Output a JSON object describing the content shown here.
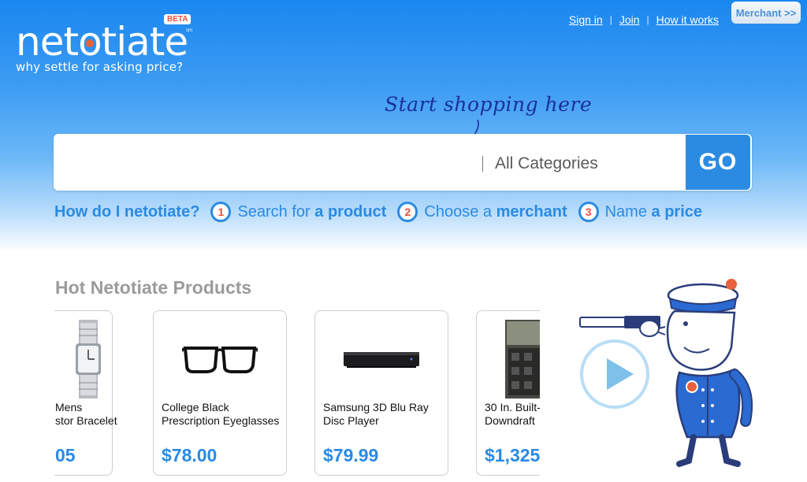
{
  "logo": {
    "name_a": "net",
    "name_b": "tiate",
    "beta": "BETA",
    "sm": "sm",
    "tagline": "why settle for asking price?"
  },
  "nav": {
    "sign_in": "Sign in",
    "separator": "|",
    "join": "Join",
    "how_it_works": "How it works",
    "merchant": "Merchant >>"
  },
  "hint": "Start shopping here",
  "search": {
    "value": "",
    "placeholder": "",
    "category": "All Categories",
    "go": "GO"
  },
  "howto": {
    "question": "How do I netotiate?",
    "steps": [
      {
        "num": "1",
        "prefix": "Search for",
        "bold": "a product"
      },
      {
        "num": "2",
        "prefix": "Choose a",
        "bold": "merchant"
      },
      {
        "num": "3",
        "prefix": "Name",
        "bold": "a price"
      }
    ]
  },
  "hot": {
    "title": "Hot Netotiate Products",
    "products": [
      {
        "name": "Mens Fossil Stainless Steel Analog Quartz Transistor Bracelet",
        "price_visible": "05",
        "name_line1": "Mens",
        "name_line2": "stor Bracelet"
      },
      {
        "name": "College Black Prescription Eyeglasses",
        "price": "$78.00"
      },
      {
        "name": "Samsung 3D Blu Ray Disc Player",
        "price": "$79.99"
      },
      {
        "name_visible": "30 In. Built-",
        "name_visible2": "Downdraft",
        "price_visible": "$1,325"
      }
    ]
  },
  "colors": {
    "brand_blue": "#2a8ae3",
    "accent_orange": "#e8513a",
    "price_blue": "#2a8ae3"
  },
  "icons": {
    "play": "play-icon",
    "go_arrow": "arrow-icon"
  }
}
